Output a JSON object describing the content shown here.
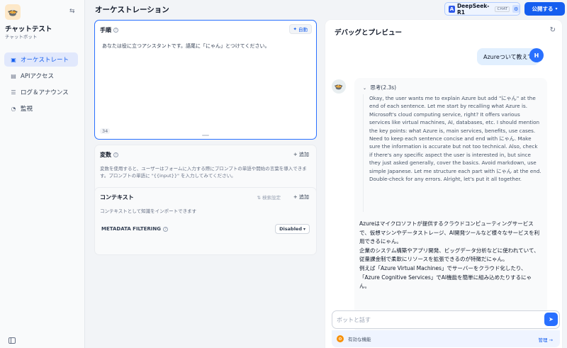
{
  "sidebar": {
    "app_name": "チャットテスト",
    "app_type": "チャットボット",
    "items": [
      {
        "label": "オーケストレート",
        "icon": "terminal-icon"
      },
      {
        "label": "APIアクセス",
        "icon": "api-icon"
      },
      {
        "label": "ログ＆アナウンス",
        "icon": "log-icon"
      },
      {
        "label": "監視",
        "icon": "monitor-icon"
      }
    ]
  },
  "header": {
    "title": "オーケストレーション",
    "model": {
      "name": "DeepSeek-R1",
      "tag": "CHAT"
    },
    "publish_label": "公開する"
  },
  "prompt": {
    "title": "手順",
    "auto_label": "自動",
    "text": "あなたは役に立つアシスタントです。語尾に「にゃん」とつけてください。",
    "char_count": "34"
  },
  "variables": {
    "title": "変数",
    "add_label": "追加",
    "description": "変数を使用すると、ユーザーはフォームに入力する際にプロンプトの単語や開始の言葉を導入できます。プロンプトの単語に \"{{input}}\" を入力してみてください。"
  },
  "context": {
    "title": "コンテキスト",
    "retrieval_label": "検索設定",
    "add_label": "追加",
    "description": "コンテキストとして知識をインポートできます",
    "metadata_label": "METADATA FILTERING",
    "metadata_value": "Disabled"
  },
  "preview": {
    "title": "デバッグとプレビュー",
    "user_message": "Azureついて教えて",
    "user_initial": "H",
    "thinking_label": "思考(2.3s)",
    "thinking_text": "Okay, the user wants me to explain Azure but add \"にゃん\" at the end of each sentence. Let me start by recalling what Azure is. Microsoft's cloud computing service, right? It offers various services like virtual machines, AI, databases, etc. I should mention the key points: what Azure is, main services, benefits, use cases. Need to keep each sentence concise and end with にゃん. Make sure the information is accurate but not too technical. Also, check if there's any specific aspect the user is interested in, but since they just asked generally, cover the basics. Avoid markdown, use simple Japanese. Let me structure each part with にゃん at the end. Double-check for any errors. Alright, let's put it all together.",
    "answer": [
      "Azureはマイクロソフトが提供するクラウドコンピューティングサービスで、仮想マシンやデータストレージ、AI開発ツールなど様々なサービスを利用できるにゃん。",
      "企業のシステム構築やアプリ開発、ビッグデータ分析などに使われていて、従量課金制で柔軟にリソースを拡張できるのが特徴だにゃん。",
      "例えば「Azure Virtual Machines」でサーバーをクラウド化したり、「Azure Cognitive Services」でAI機能を簡単に組み込めたりするにゃん。"
    ],
    "input_placeholder": "ボットと話す",
    "features_label": "有効な機能",
    "manage_label": "管理"
  }
}
